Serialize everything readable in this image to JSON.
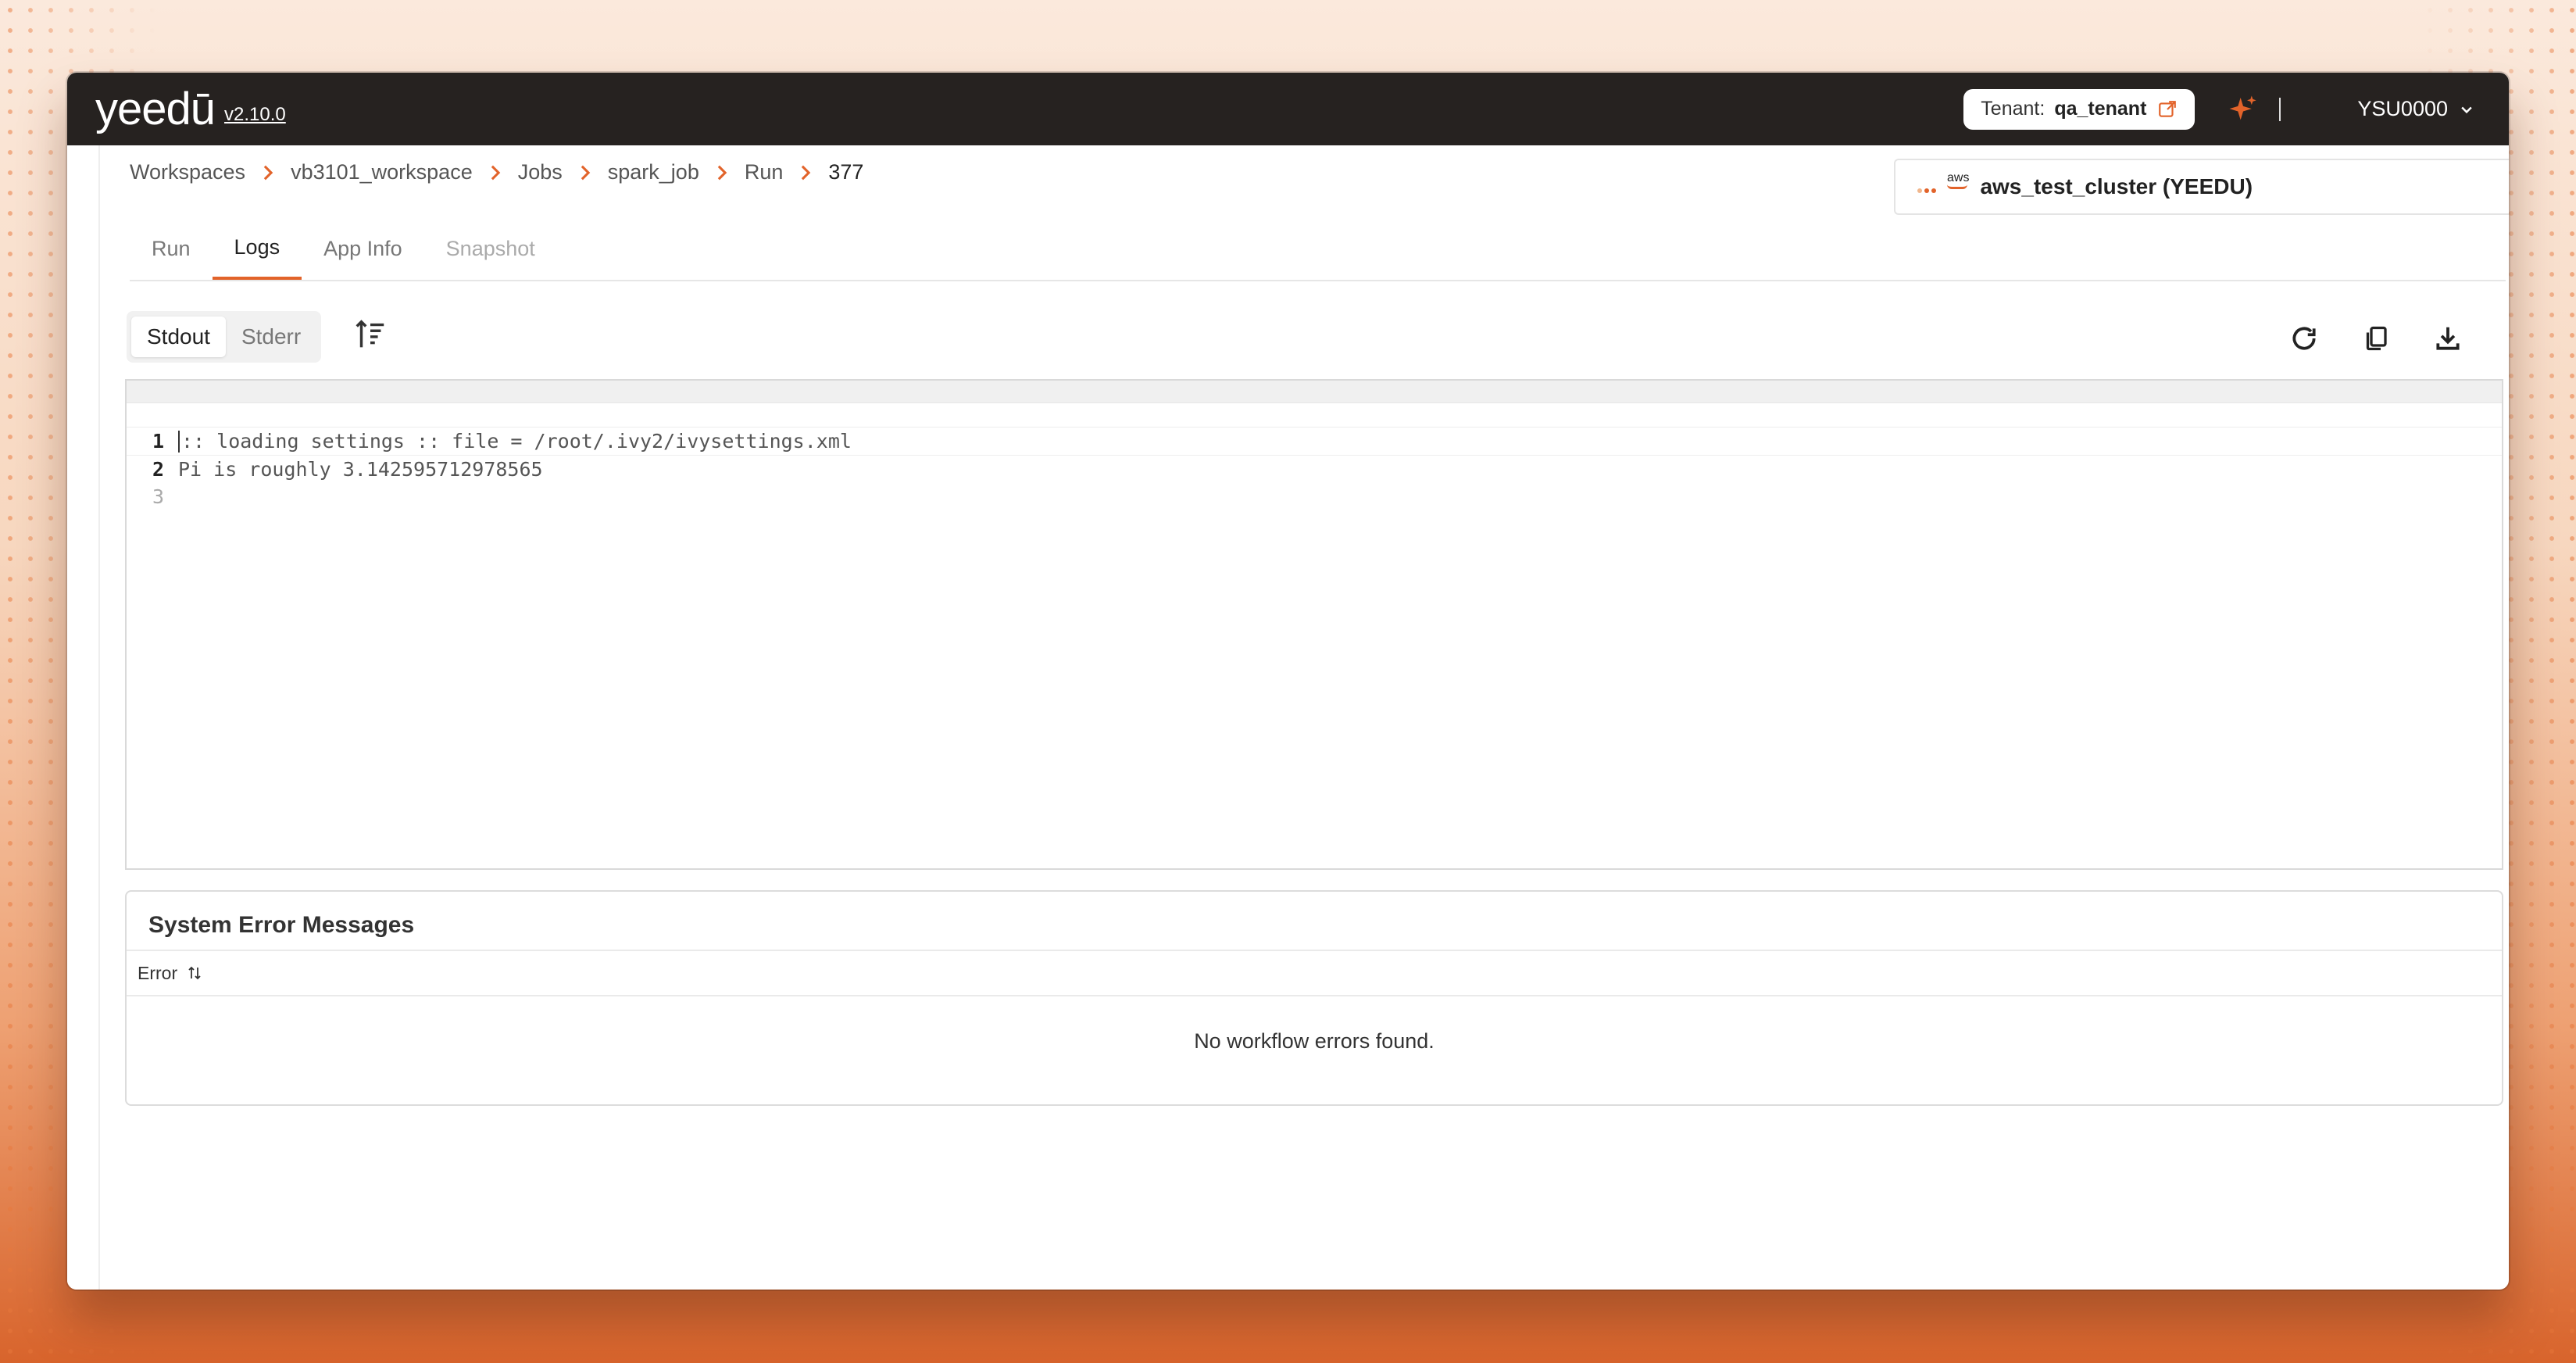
{
  "app": {
    "logo": "yeedū",
    "version": "v2.10.0",
    "tenant_label": "Tenant:",
    "tenant_value": "qa_tenant",
    "user": "YSU0000"
  },
  "breadcrumb": {
    "items": [
      "Workspaces",
      "vb3101_workspace",
      "Jobs",
      "spark_job",
      "Run"
    ],
    "current": "377"
  },
  "cluster": {
    "provider": "aws",
    "name": "aws_test_cluster (YEEDU)"
  },
  "tabs": [
    {
      "label": "Run"
    },
    {
      "label": "Logs"
    },
    {
      "label": "App Info"
    },
    {
      "label": "Snapshot"
    }
  ],
  "log_stream": {
    "options": [
      "Stdout",
      "Stderr"
    ],
    "selected": "Stdout"
  },
  "editor": {
    "lines": [
      {
        "num": "1",
        "text": ":: loading settings :: file = /root/.ivy2/ivysettings.xml"
      },
      {
        "num": "2",
        "text": "Pi is roughly 3.142595712978565"
      },
      {
        "num": "3",
        "text": ""
      }
    ]
  },
  "errors": {
    "title": "System Error Messages",
    "column": "Error",
    "empty_message": "No workflow errors found."
  },
  "colors": {
    "accent": "#e2632a",
    "topbar": "#262220"
  }
}
